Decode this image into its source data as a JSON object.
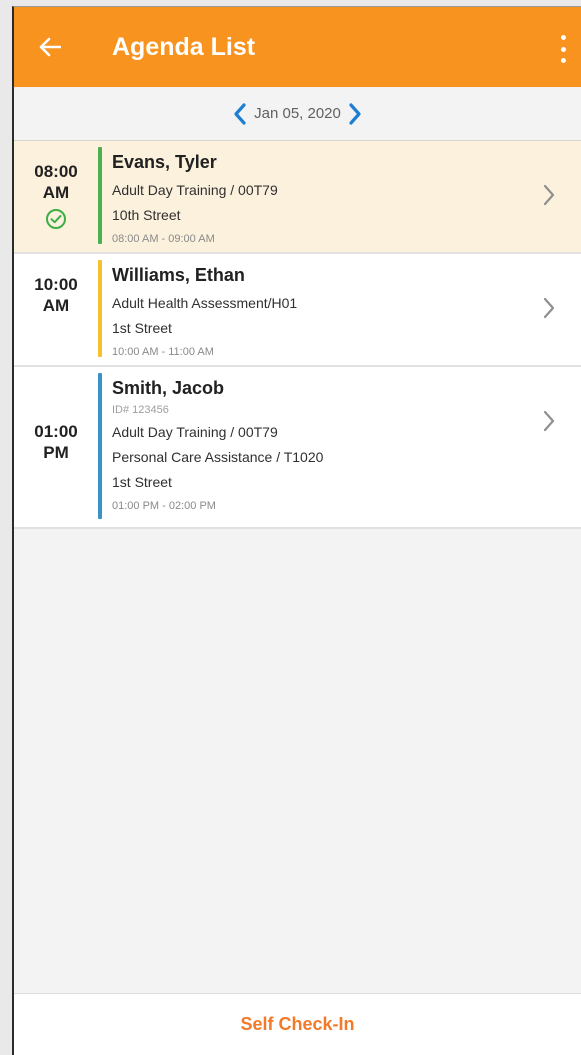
{
  "app_bar": {
    "title": "Agenda List",
    "back_icon": "arrow-left-icon",
    "menu_icon": "more-vertical-icon",
    "background_color": "#f7931e"
  },
  "date_nav": {
    "date": "Jan 05, 2020",
    "prev_icon": "chevron-left-icon",
    "next_icon": "chevron-right-icon",
    "arrow_color": "#1e7ed1"
  },
  "agenda": [
    {
      "time": "08:00",
      "meridiem": "AM",
      "name": "Evans, Tyler",
      "id_line": "",
      "services": [
        "Adult Day Training / 00T79"
      ],
      "location": "10th Street",
      "time_range": "08:00 AM - 09:00 AM",
      "bar_color": "#4caf50",
      "status_icon": "check-circle-icon",
      "selected": true
    },
    {
      "time": "10:00",
      "meridiem": "AM",
      "name": "Williams, Ethan",
      "id_line": "",
      "services": [
        "Adult Health Assessment/H01"
      ],
      "location": "1st Street",
      "time_range": "10:00 AM - 11:00 AM",
      "bar_color": "#f6c12e",
      "status_icon": "",
      "selected": false
    },
    {
      "time": "01:00",
      "meridiem": "PM",
      "name": "Smith, Jacob",
      "id_line": "ID# 123456",
      "services": [
        "Adult Day Training / 00T79",
        "Personal Care Assistance / T1020"
      ],
      "location": "1st Street",
      "time_range": "01:00 PM - 02:00 PM",
      "bar_color": "#3a93c4",
      "status_icon": "",
      "selected": false
    }
  ],
  "footer": {
    "button_label": "Self Check-In",
    "button_color": "#f37a2a"
  }
}
